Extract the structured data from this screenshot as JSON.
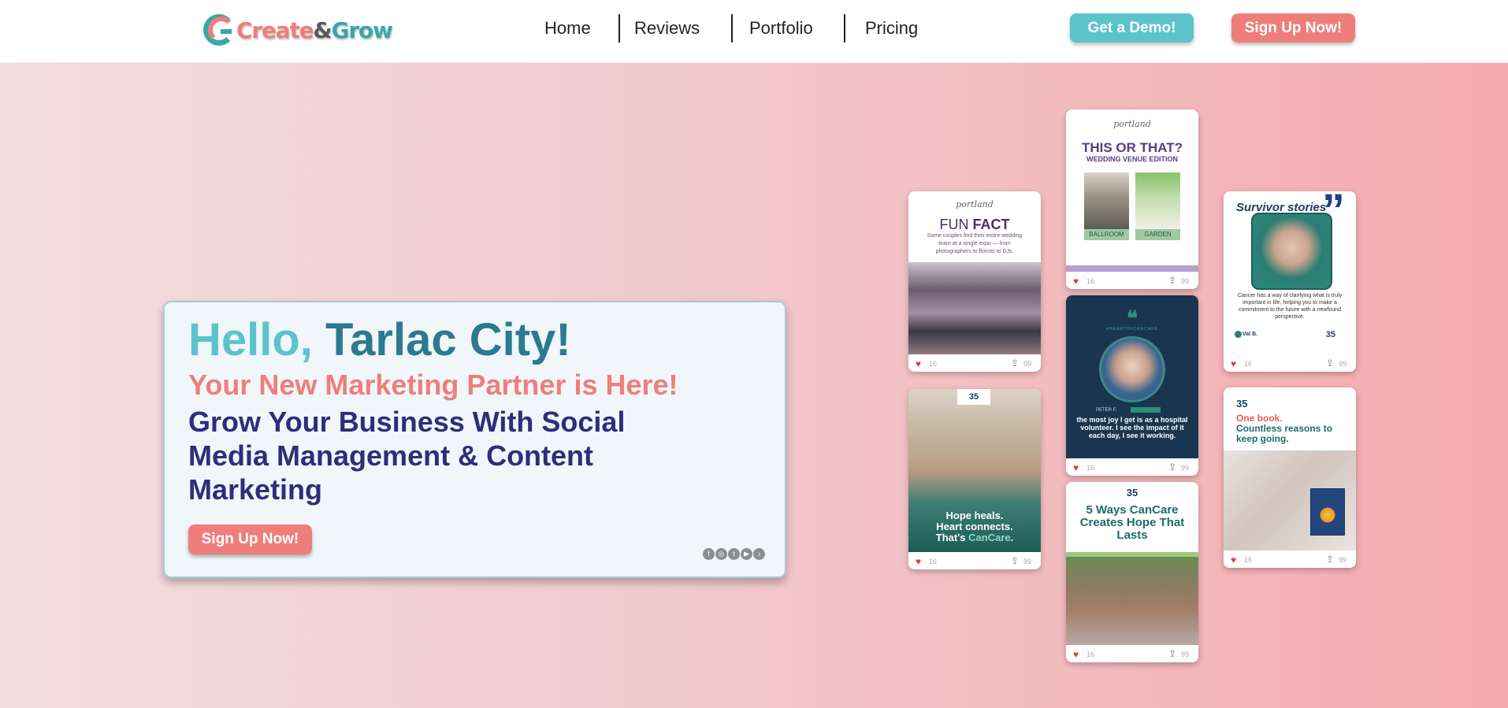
{
  "header": {
    "logo": {
      "part1": "Create",
      "amp": "&",
      "part2": "Grow"
    },
    "nav": [
      "Home",
      "Reviews",
      "Portfolio",
      "Pricing"
    ],
    "demo_label": "Get a Demo!",
    "signup_label": "Sign Up Now!"
  },
  "hero": {
    "hello": "Hello,",
    "city": "Tarlac City!",
    "subtitle": "Your New Marketing Partner is Here!",
    "headline": "Grow Your Business With Social Media Management & Content Marketing",
    "cta_label": "Sign Up Now!",
    "socials": [
      "facebook-icon",
      "instagram-icon",
      "twitter-icon",
      "youtube-icon",
      "tiktok-icon"
    ]
  },
  "posts": {
    "fun_fact": {
      "title_a": "FUN",
      "title_b": "FACT",
      "desc": "Some couples find their entire wedding team at a single expo — from photographers to florists to DJs."
    },
    "this_or_that": {
      "title": "THIS OR THAT?",
      "subtitle": "WEDDING VENUE EDITION",
      "option_a": "BALLROOM",
      "option_b": "GARDEN"
    },
    "survivor": {
      "title": "Survivor stories",
      "quote": "Cancer has a way of clarifying what is truly important in life, helping you to make a commitment to the future with a newfound perspective.",
      "name": "Val B."
    },
    "heart": {
      "hashtag": "#HEARTOFCANCARE",
      "name": "PETER F.",
      "quote": "the most joy I get is as a hospital volunteer. I see the impact of it each day, I see it working."
    },
    "hope": {
      "line1": "Hope heals.",
      "line2": "Heart connects.",
      "line3a": "That's ",
      "line3b": "CanCare",
      "line3c": "."
    },
    "five_ways": {
      "title": "5 Ways CanCare Creates Hope That Lasts"
    },
    "one_book": {
      "line1": "One book.",
      "line2": "Countless reasons to keep going."
    },
    "likes": "16",
    "shares": "99",
    "mini_logo": "35"
  },
  "colors": {
    "teal": "#5cc3cb",
    "dark_teal": "#2b7a8f",
    "coral": "#ef7e7b",
    "navy": "#2d2e7a"
  }
}
